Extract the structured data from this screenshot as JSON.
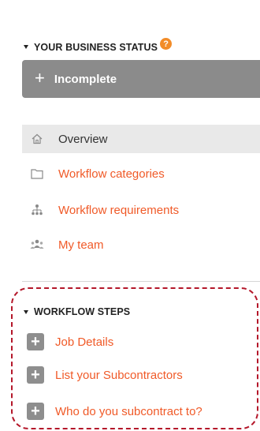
{
  "business_status": {
    "header": "YOUR BUSINESS STATUS",
    "help_badge": "?",
    "status_label": "Incomplete"
  },
  "nav": {
    "items": [
      {
        "label": "Overview",
        "icon": "home-icon",
        "active": true
      },
      {
        "label": "Workflow categories",
        "icon": "folder-icon",
        "active": false
      },
      {
        "label": "Workflow requirements",
        "icon": "hierarchy-icon",
        "active": false
      },
      {
        "label": "My team",
        "icon": "team-icon",
        "active": false
      }
    ]
  },
  "workflow_steps": {
    "header": "WORKFLOW STEPS",
    "items": [
      {
        "label": "Job Details"
      },
      {
        "label": "List your Subcontractors"
      },
      {
        "label": "Who do you subcontract to?"
      }
    ]
  },
  "colors": {
    "accent": "#f05a28",
    "status_bar": "#8b8b8b",
    "badge": "#f28c28",
    "dashed_outline": "#b4172a"
  }
}
